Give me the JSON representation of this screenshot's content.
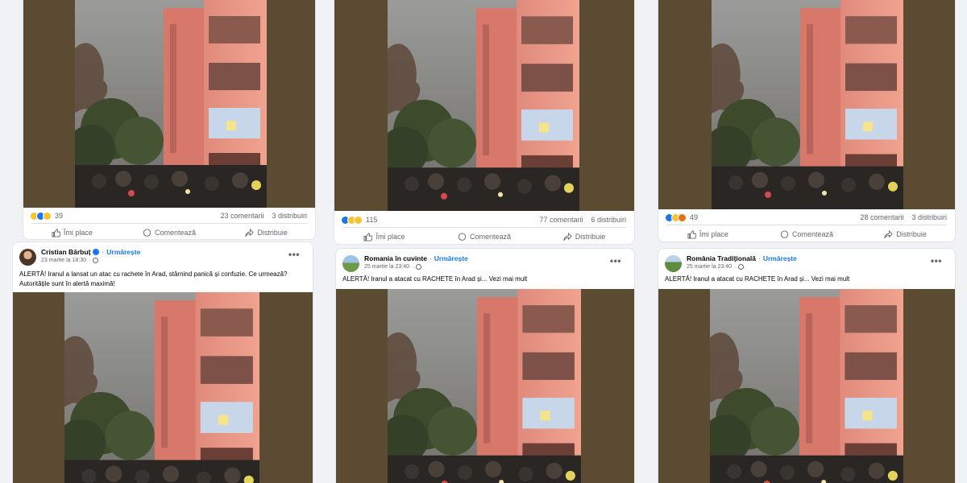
{
  "colors": {
    "page_bg": "#f0f2f5",
    "accent": "#1877f2",
    "muted": "#65676b",
    "photo_bg": "#5b4b33"
  },
  "actions": {
    "like": "Îmi place",
    "comment": "Comentează",
    "share": "Distribuie"
  },
  "top_posts": [
    {
      "reactions": [
        "haha",
        "like",
        "sad"
      ],
      "reaction_count": "39",
      "comments": "23 comentarii",
      "shares": "3 distribuiri"
    },
    {
      "reactions": [
        "like",
        "haha",
        "sad"
      ],
      "reaction_count": "115",
      "comments": "77 comentarii",
      "shares": "6 distribuiri"
    },
    {
      "reactions": [
        "like",
        "haha",
        "angry"
      ],
      "reaction_count": "49",
      "comments": "28 comentarii",
      "shares": "3 distribuiri"
    }
  ],
  "bottom_posts": [
    {
      "author": "Cristian Bărbuț",
      "verified": true,
      "follow": "Urmărește",
      "date": "23 martie la 18:30",
      "text": "ALERTĂ! Iranul a lansat un atac cu rachete în Arad, stârnind panică și confuzie. Ce urmează? Autoritățile sunt în alertă maximă!"
    },
    {
      "author": "Romania în cuvinte",
      "verified": false,
      "follow": "Urmărește",
      "date": "25 martie la 23:40",
      "text": "ALERTĂ! Iranul a atacat cu RACHETE în Arad și... Vezi mai mult"
    },
    {
      "author": "România Tradițională",
      "verified": false,
      "follow": "Urmărește",
      "date": "25 martie la 23:40",
      "text": "ALERTĂ! Iranul a atacat cu RACHETE în Arad și... Vezi mai mult"
    }
  ]
}
